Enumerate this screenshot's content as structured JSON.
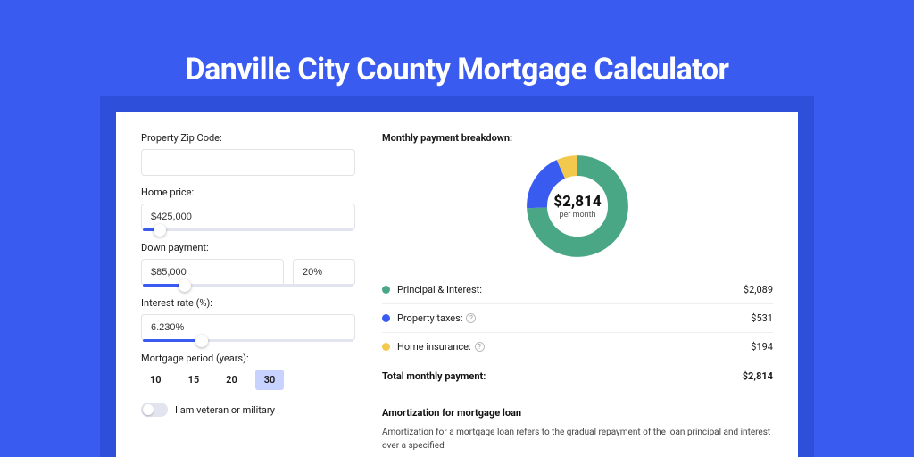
{
  "title": "Danville City County Mortgage Calculator",
  "form": {
    "zip_label": "Property Zip Code:",
    "zip_value": "",
    "home_price_label": "Home price:",
    "home_price_value": "$425,000",
    "down_payment_label": "Down payment:",
    "down_payment_value": "$85,000",
    "down_payment_pct": "20%",
    "rate_label": "Interest rate (%):",
    "rate_value": "6.230%",
    "period_label": "Mortgage period (years):",
    "period_options": [
      "10",
      "15",
      "20",
      "30"
    ],
    "period_selected": "30",
    "veteran_label": "I am veteran or military",
    "slider_positions": {
      "home_price": 8,
      "down_payment": 20,
      "rate": 28
    }
  },
  "breakdown": {
    "title": "Monthly payment breakdown:",
    "center_value": "$2,814",
    "center_sub": "per month",
    "items": [
      {
        "label": "Principal & Interest:",
        "value": "$2,089",
        "color": "#4AA785",
        "help": false
      },
      {
        "label": "Property taxes:",
        "value": "$531",
        "color": "#3A5BF0",
        "help": true
      },
      {
        "label": "Home insurance:",
        "value": "$194",
        "color": "#F2C94C",
        "help": true
      }
    ],
    "total_label": "Total monthly payment:",
    "total_value": "$2,814"
  },
  "amort": {
    "title": "Amortization for mortgage loan",
    "body": "Amortization for a mortgage loan refers to the gradual repayment of the loan principal and interest over a specified"
  },
  "chart_data": {
    "type": "pie",
    "title": "Monthly payment breakdown",
    "series": [
      {
        "name": "Principal & Interest",
        "value": 2089,
        "color": "#4AA785"
      },
      {
        "name": "Property taxes",
        "value": 531,
        "color": "#3A5BF0"
      },
      {
        "name": "Home insurance",
        "value": 194,
        "color": "#F2C94C"
      }
    ],
    "total": 2814,
    "unit": "USD/month"
  }
}
